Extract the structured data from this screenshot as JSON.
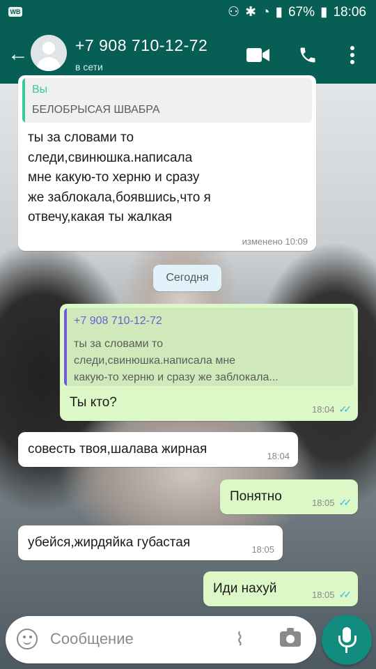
{
  "status_bar": {
    "left_badge": "WB",
    "battery": "67%",
    "time": "18:06"
  },
  "header": {
    "contact": "+7 908 710-12-72",
    "status": "в сети",
    "icons": [
      "back-arrow-icon",
      "avatar",
      "video-call-icon",
      "phone-icon",
      "more-vert-icon"
    ],
    "color": "#075e54"
  },
  "messages": [
    {
      "direction": "incoming",
      "quote": {
        "author": "Вы",
        "text": "БЕЛОБРЫСАЯ ШВАБРА"
      },
      "text_lines": [
        "ты за словами то",
        "следи,свинюшка.написала",
        "мне какую-то херню и сразу",
        "же заблокала,боявшись,что я",
        "отвечу,какая ты жалкая"
      ],
      "time": "изменено 10:09"
    },
    {
      "direction": "outgoing",
      "quote": {
        "author": "+7 908 710-12-72",
        "text_lines": [
          "ты за словами то",
          "следи,свинюшка.написала мне",
          "какую-то херню и сразу же заблокала..."
        ]
      },
      "text": "Ты кто?",
      "time": "18:04",
      "read": true
    },
    {
      "direction": "incoming",
      "text": "совесть твоя,шалава жирная",
      "time": "18:04"
    },
    {
      "direction": "outgoing",
      "text": "Понятно",
      "time": "18:05",
      "read": true
    },
    {
      "direction": "incoming",
      "text": "убейся,жирдяйка губастая",
      "time": "18:05"
    },
    {
      "direction": "outgoing",
      "text": "Иди нахуй",
      "time": "18:05",
      "read": true
    }
  ],
  "date_divider": "Сегодня",
  "composer": {
    "placeholder": "Сообщение",
    "icons": [
      "emoji-icon",
      "attach-icon",
      "camera-icon",
      "mic-icon"
    ]
  },
  "colors": {
    "outgoing_bubble": "#dcf8c6",
    "incoming_bubble": "#ffffff",
    "read_ticks": "#34b7f1",
    "mic_button": "#128c7e"
  }
}
